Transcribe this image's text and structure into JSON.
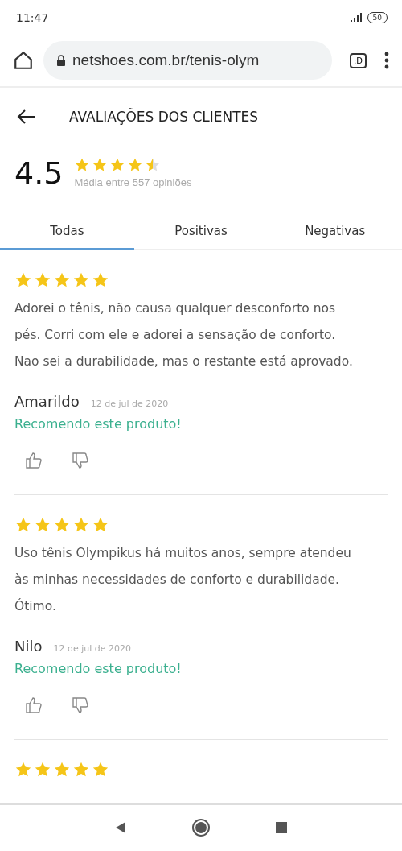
{
  "status_bar": {
    "time": "11:47",
    "battery": "50"
  },
  "browser": {
    "url": "netshoes.com.br/tenis-olym",
    "tabs_button": ":D"
  },
  "header": {
    "title": "AVALIAÇÕES DOS CLIENTES"
  },
  "summary": {
    "score": "4.5",
    "stars": 4.5,
    "caption": "Média entre 557 opiniões"
  },
  "tabs": [
    {
      "label": "Todas",
      "selected": true
    },
    {
      "label": "Positivas",
      "selected": false
    },
    {
      "label": "Negativas",
      "selected": false
    }
  ],
  "reviews": [
    {
      "stars": 5,
      "text": "Adorei o tênis, não causa qualquer desconforto nos pés. Corri com ele e adorei a sensação de conforto. Nao sei a durabilidade, mas o restante está aprovado.",
      "author": "Amarildo",
      "date": "12 de jul de 2020",
      "recommendation": "Recomendo este produto!"
    },
    {
      "stars": 5,
      "text": "Uso tênis Olympikus há muitos anos, sempre atendeu às minhas necessidades de conforto e durabilidade. Ótimo.",
      "author": "Nilo",
      "date": "12 de jul de 2020",
      "recommendation": "Recomendo este produto!"
    },
    {
      "stars": 5
    }
  ]
}
